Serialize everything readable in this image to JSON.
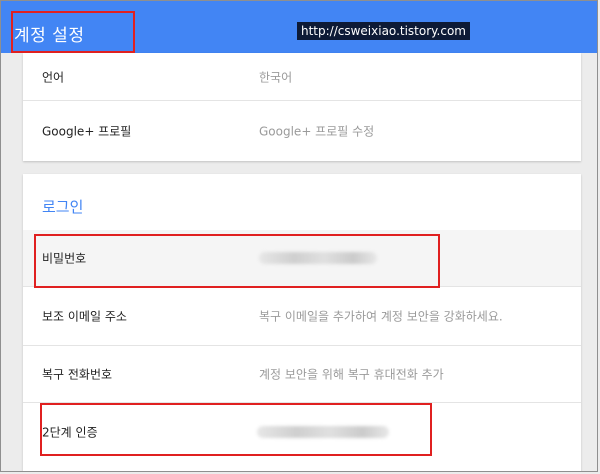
{
  "header": {
    "title": "계정 설정",
    "watermark": "http://csweixiao.tistory.com",
    "color": "#4285f4"
  },
  "general": {
    "rows": [
      {
        "label": "언어",
        "value": "한국어"
      },
      {
        "label": "Google+ 프로필",
        "value": "Google+ 프로필 수정"
      }
    ]
  },
  "login": {
    "title": "로그인",
    "rows": [
      {
        "label": "비밀번호",
        "value": ""
      },
      {
        "label": "보조 이메일 주소",
        "value": "복구 이메일을 추가하여 계정 보안을 강화하세요."
      },
      {
        "label": "복구 전화번호",
        "value": "계정 보안을 위해 복구 휴대전화 추가"
      },
      {
        "label": "2단계 인증",
        "value": ""
      }
    ]
  },
  "highlight_color": "#e02020"
}
